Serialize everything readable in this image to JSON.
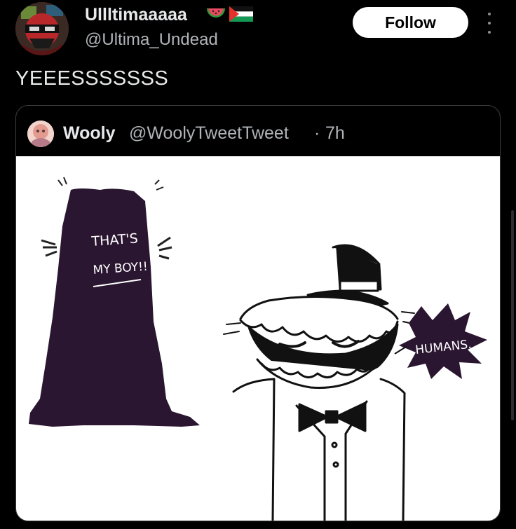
{
  "post": {
    "display_name": "Ullltimaaaaa",
    "handle": "@Ultima_Undead",
    "follow_label": "Follow",
    "text": "YEEESSSSSSS",
    "name_emojis": [
      "watermelon-icon",
      "palestine-flag-icon"
    ]
  },
  "quote": {
    "name": "Wooly",
    "handle": "@WoolyTweetTweet",
    "separator": "·",
    "time": "7h",
    "image": {
      "caption_left": [
        "THAT'S",
        "MY BOY!!"
      ],
      "caption_right": "HUMANS."
    }
  },
  "colors": {
    "background": "#000000",
    "text": "#e7e9ea",
    "secondary_text": "#b0b3b8",
    "follow_bg": "#ffffff",
    "silhouette": "#2a1630"
  }
}
